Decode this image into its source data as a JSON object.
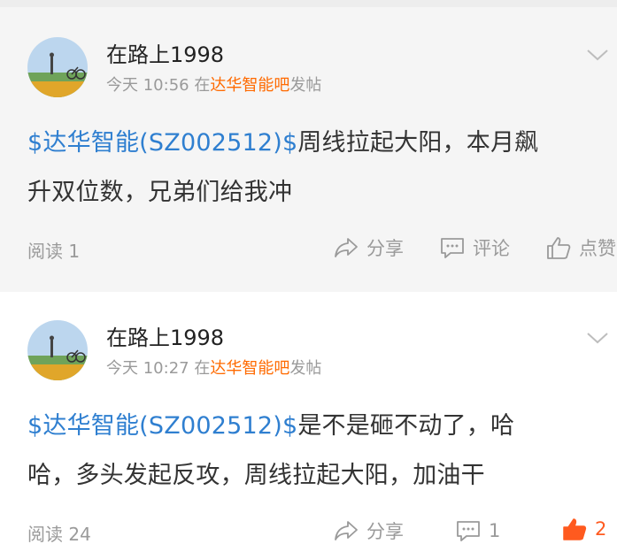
{
  "posts": [
    {
      "author": "在路上1998",
      "time": "今天 10:56",
      "meta_prefix": "在",
      "bar_name": "达华智能吧",
      "meta_suffix": "发帖",
      "stock_tag": "$达华智能(SZ002512)$",
      "text_line1": "周线拉起大阳，本月飙",
      "text_line2": "升双位数，兄弟们给我冲",
      "read_label": "阅读 1",
      "share_label": "分享",
      "comment_label": "评论",
      "like_label": "点赞"
    },
    {
      "author": "在路上1998",
      "time": "今天 10:27",
      "meta_prefix": "在",
      "bar_name": "达华智能吧",
      "meta_suffix": "发帖",
      "stock_tag": "$达华智能(SZ002512)$",
      "text_line1": "是不是砸不动了，哈",
      "text_line2": "哈，多头发起反攻，周线拉起大阳，加油干",
      "read_label": "阅读 24",
      "share_label": "分享",
      "comment_count": "1",
      "like_count": "2"
    }
  ],
  "colors": {
    "stock_link": "#2f7fd0",
    "bar_link": "#ff6a00",
    "like_active": "#ff5a1f"
  },
  "icons": [
    "chevron-down-icon",
    "share-icon",
    "comment-icon",
    "thumbs-up-icon"
  ]
}
